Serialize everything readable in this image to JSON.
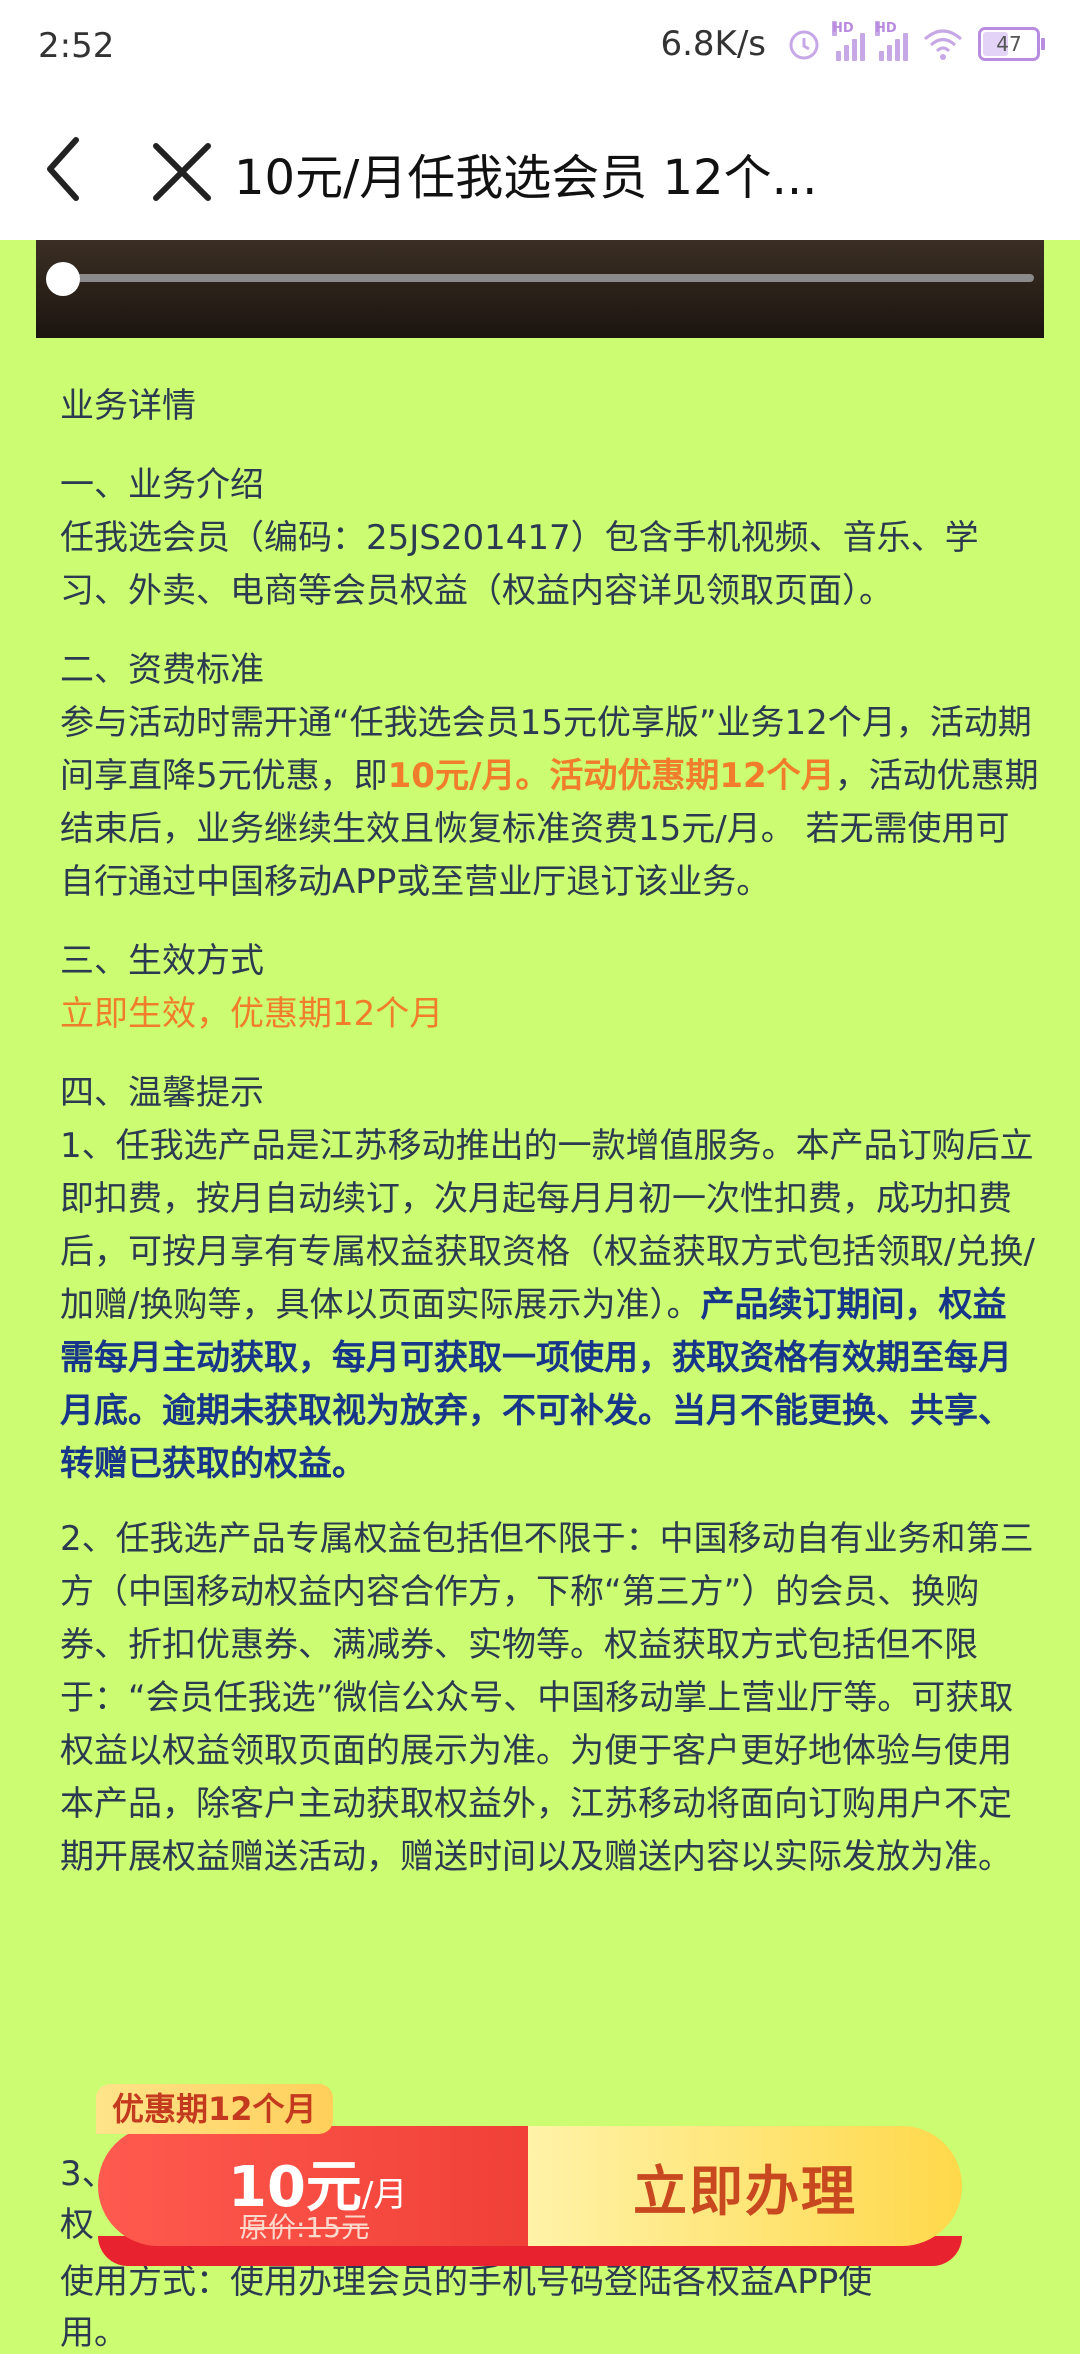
{
  "status": {
    "time": "2:52",
    "speed": "6.8K/s",
    "battery": "47",
    "hd": "HD"
  },
  "nav": {
    "title": "10元/月任我选会员 12个..."
  },
  "content": {
    "heading": "业务详情",
    "s1_title": "一、业务介绍",
    "s1_body": "任我选会员（编码：25JS201417）包含手机视频、音乐、学习、外卖、电商等会员权益（权益内容详见领取页面）。",
    "s2_title": "二、资费标准",
    "s2_a": "参与活动时需开通“任我选会员15元优享版”业务12个月，活动期间享直降5元优惠，即",
    "s2_hl": "10元/月。活动优惠期12个月",
    "s2_b": "，活动优惠期结束后，业务继续生效且恢复标准资费15元/月。 若无需使用可自行通过中国移动APP或至营业厅退订该业务。",
    "s3_title": "三、生效方式",
    "s3_body": "立即生效，优惠期12个月",
    "s4_title": "四、温馨提示",
    "s4_p1a": "1、任我选产品是江苏移动推出的一款增值服务。本产品订购后立即扣费，按月自动续订，次月起每月月初一次性扣费，成功扣费后，可按月享有专属权益获取资格（权益获取方式包括领取/兑换/加赠/换购等，具体以页面实际展示为准）。",
    "s4_p1b": "产品续订期间，权益需每月主动获取，每月可获取一项使用，获取资格有效期至每月月底。逾期未获取视为放弃，不可补发。当月不能更换、共享、转赠已获取的权益。",
    "s4_p2": "2、任我选产品专属权益包括但不限于：中国移动自有业务和第三方（中国移动权益内容合作方，下称“第三方”）的会员、换购券、折扣优惠券、满减券、实物等。权益获取方式包括但不限于：“会员任我选”微信公众号、中国移动掌上营业厅等。可获取权益以权益领取页面的展示为准。为便于客户更好地体验与使用本产品，除客户主动获取权益外，江苏移动将面向订购用户不定期开展权益赠送活动，赠送时间以及赠送内容以实际发放为准。",
    "s4_p3_start": "3、",
    "s4_p3_line2": "权",
    "s4_p3_line3": "使用方式：使用办理会员的手机号码登陆各权益APP使",
    "s4_p3_line4": "用。"
  },
  "cta": {
    "promo_tag": "优惠期12个月",
    "price": "10元",
    "unit": "/月",
    "original": "原价:15元",
    "apply": "立即办理"
  }
}
